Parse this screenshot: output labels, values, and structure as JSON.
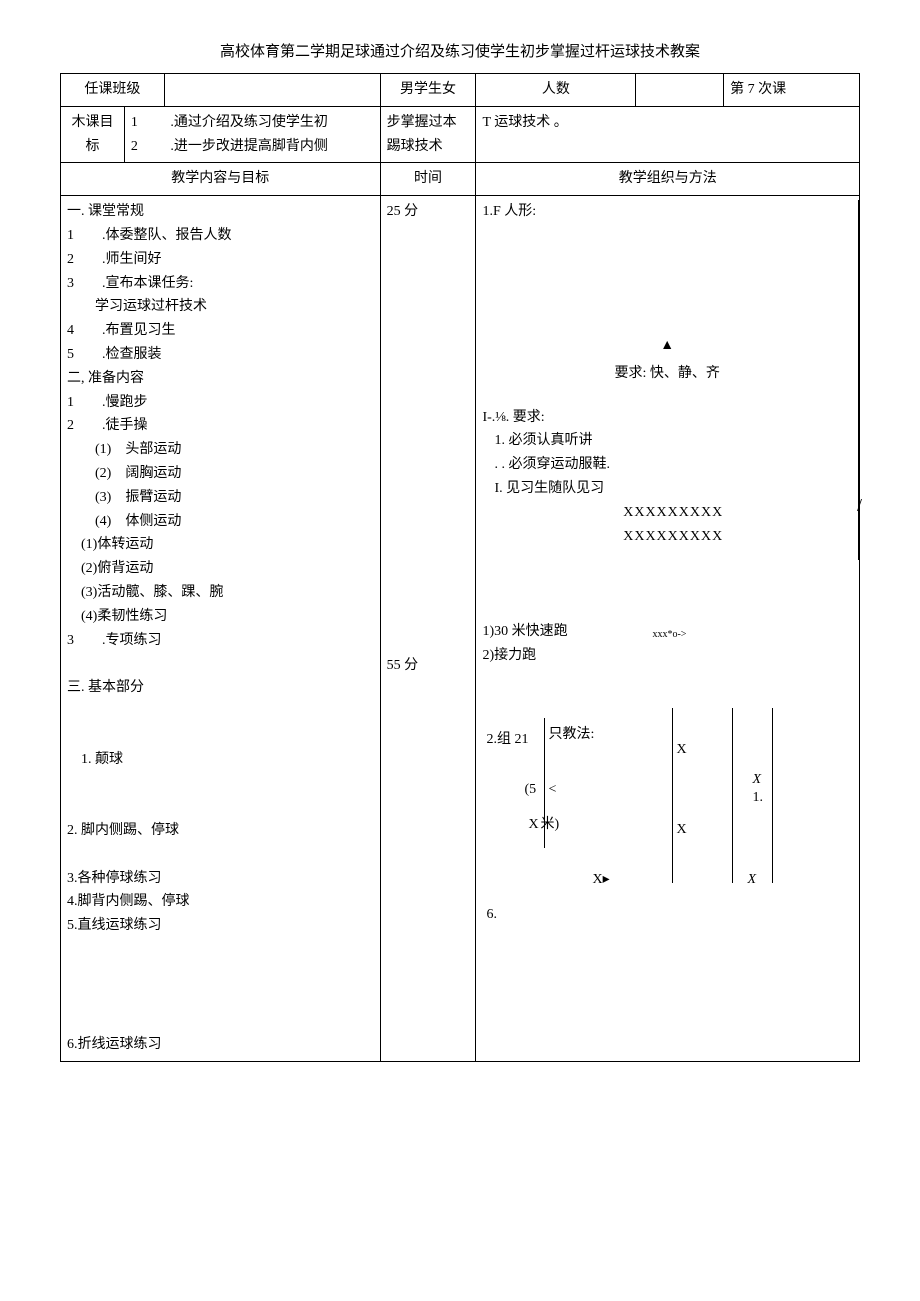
{
  "title": "高校体育第二学期足球通过介绍及练习使学生初步掌握过杆运球技术教案",
  "header": {
    "class_label": "任课班级",
    "gender_label": "男学生女",
    "count_label": "人数",
    "lesson_no": "第 7 次课"
  },
  "goal": {
    "label": "木课目标",
    "n1": "1",
    "n2": "2",
    "t1": ".通过介绍及练习使学生初",
    "t2": ".进一步改进提高脚背内侧",
    "m1": "步掌握过本",
    "m2": "踢球技术",
    "r1": "T 运球技术 。"
  },
  "cols": {
    "left": "教学内容与目标",
    "time": "时间",
    "right": "教学组织与方法"
  },
  "left_body": "一. 课堂常规\n1  .体委整队、报告人数\n2  .师生间好\n3  .宣布本课任务:\n  学习运球过杆技术\n4  .布置见习生\n5  .检查服装\n二, 准备内容\n1  .慢跑步\n2  .徒手操\n  (1) 头部运动\n  (2) 阔胸运动\n  (3) 振臂运动\n  (4) 体侧运动\n (1)体转运动\n (2)俯背运动\n (3)活动髋、膝、踝、腕\n (4)柔韧性练习\n3  .专项练习\n\n三. 基本部分\n\n\n 1. 颠球\n\n\n2. 脚内侧踢、停球\n\n3.各种停球练习\n4.脚背内侧踢、停球\n5.直线运球练习\n\n\n\n\n6.折线运球练习",
  "time1": "25 分",
  "time2": "55 分",
  "right_top": {
    "line1": "1.F 人形:",
    "tri": "▲",
    "req": "要求: 快、静、齐",
    "req2_h": "I-.⅛. 要求:",
    "req2_1": "1. 必须认真听讲",
    "req2_2": ". . 必须穿运动服鞋.",
    "req2_3": "I. 见习生随队见习",
    "xs": "XXXXXXXXX",
    "xs2": "XXXXXXXXX"
  },
  "mid": {
    "l1": "1)30 米快速跑",
    "l2": "2)接力跑",
    "tiny": "xxx*o->"
  },
  "diag": {
    "g1": "2.组 21",
    "g2": "只教法:",
    "p5": "(5",
    "lt": "<",
    "xm": "X",
    "mi": "米)",
    "xp": "X▸",
    "six": "6.",
    "ix": "X",
    "ix_it": "X",
    "one": "1."
  }
}
